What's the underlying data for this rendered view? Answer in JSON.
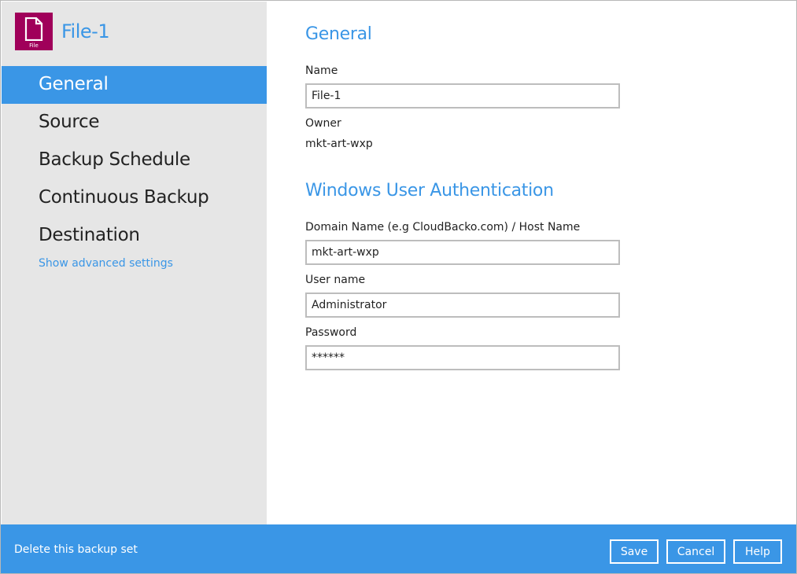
{
  "app": {
    "title": "File-1",
    "icon_caption": "File",
    "icon_name": "file-icon",
    "accent_color": "#3a96e6",
    "icon_bg_color": "#a0005a"
  },
  "sidebar": {
    "items": [
      {
        "label": "General",
        "active": true
      },
      {
        "label": "Source",
        "active": false
      },
      {
        "label": "Backup Schedule",
        "active": false
      },
      {
        "label": "Continuous Backup",
        "active": false
      },
      {
        "label": "Destination",
        "active": false
      }
    ],
    "advanced_link": "Show advanced settings"
  },
  "general": {
    "section_title": "General",
    "name_label": "Name",
    "name_value": "File-1",
    "owner_label": "Owner",
    "owner_value": "mkt-art-wxp"
  },
  "auth": {
    "section_title": "Windows User Authentication",
    "domain_label": "Domain Name (e.g CloudBacko.com) / Host Name",
    "domain_value": "mkt-art-wxp",
    "username_label": "User name",
    "username_value": "Administrator",
    "password_label": "Password",
    "password_value": "******"
  },
  "footer": {
    "delete_link": "Delete this backup set",
    "save_label": "Save",
    "cancel_label": "Cancel",
    "help_label": "Help"
  }
}
